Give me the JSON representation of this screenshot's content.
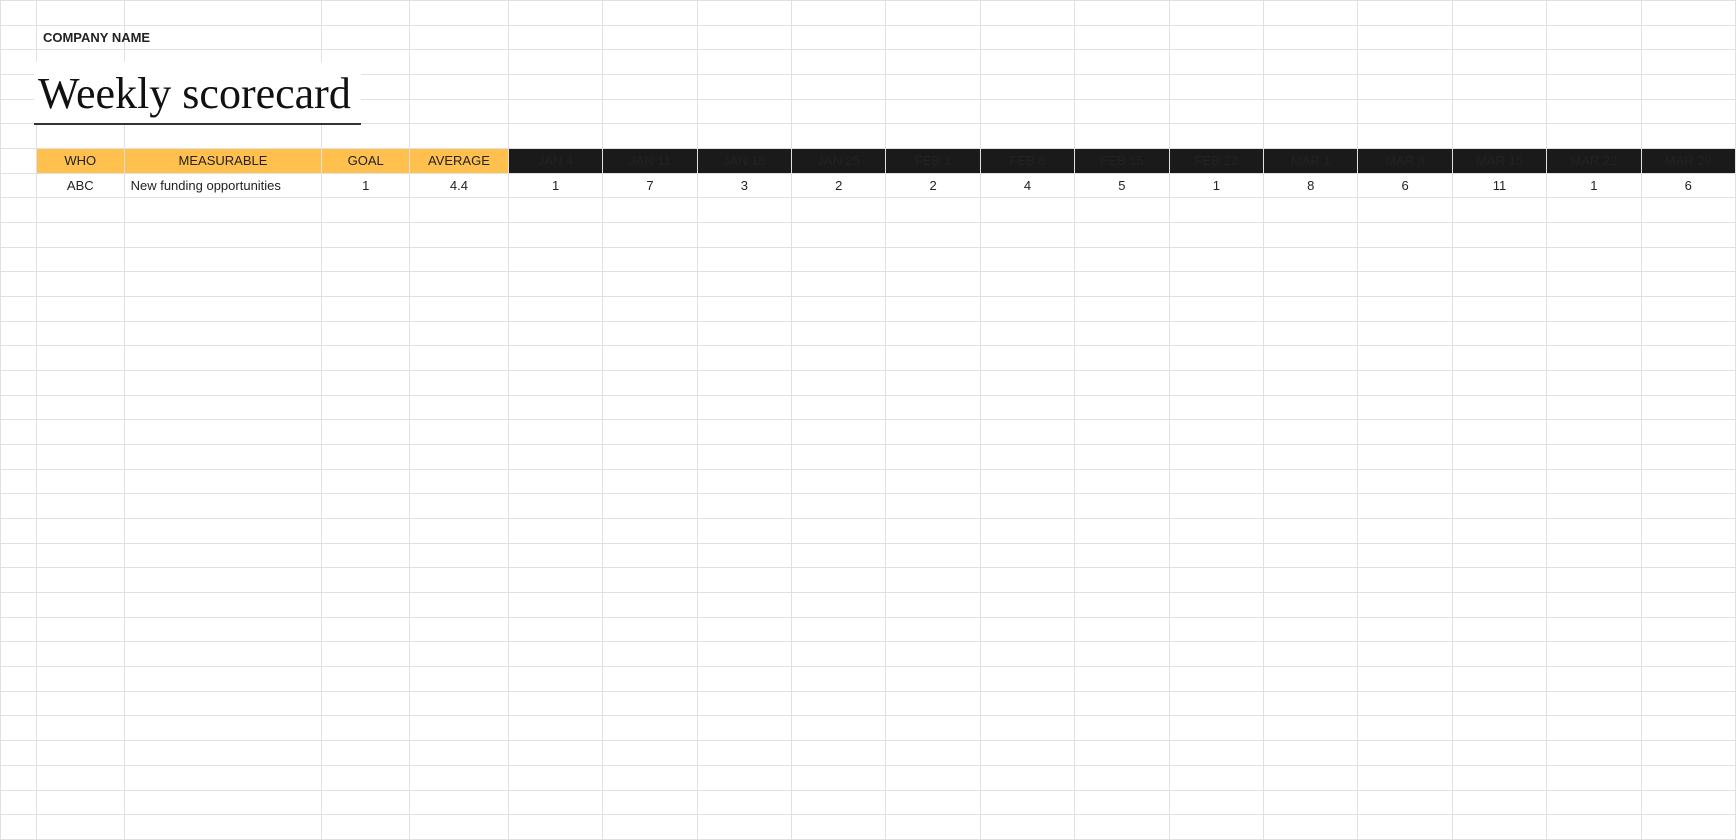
{
  "meta": {
    "company_label": "COMPANY NAME",
    "title": "Weekly scorecard"
  },
  "headers": {
    "who": "WHO",
    "measurable": "MEASURABLE",
    "goal": "GOAL",
    "average": "AVERAGE",
    "dates": [
      "JAN 4",
      "JAN 11",
      "JAN 18",
      "JAN 25",
      "FEB 1",
      "FEB 8",
      "FEB 15",
      "FEB 22",
      "MAR 1",
      "MAR 8",
      "MAR 15",
      "MAR 22",
      "MAR 29"
    ]
  },
  "rows": [
    {
      "who": "ABC",
      "measurable": "New funding opportunities",
      "goal": "1",
      "average": "4.4",
      "values": [
        "1",
        "7",
        "3",
        "2",
        "2",
        "4",
        "5",
        "1",
        "8",
        "6",
        "11",
        "1",
        "6"
      ]
    }
  ]
}
